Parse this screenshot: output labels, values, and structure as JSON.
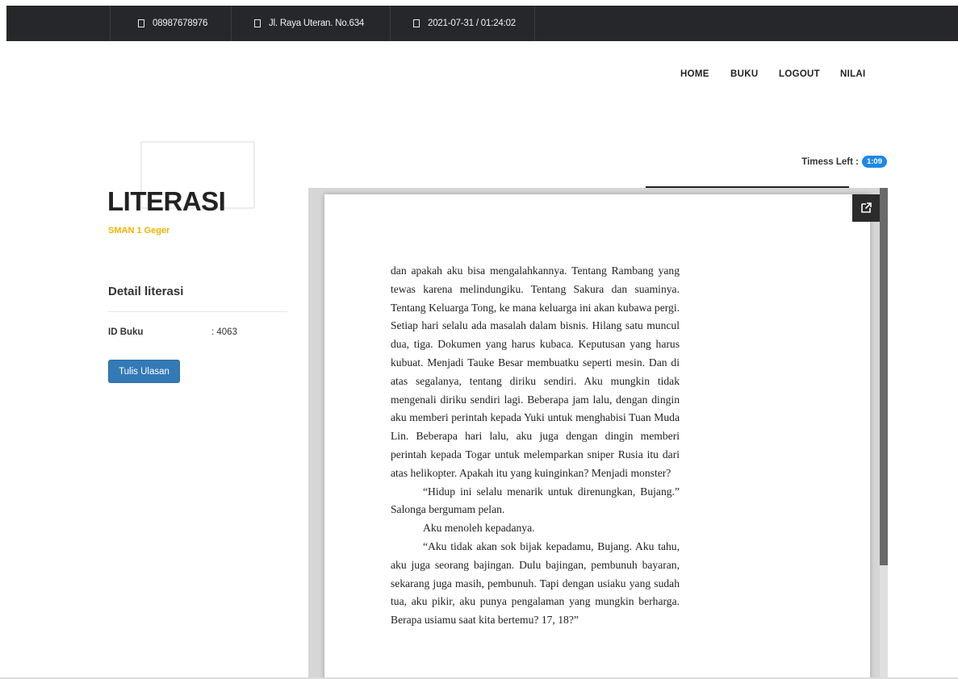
{
  "topbar": {
    "phone": "08987678976",
    "address": "Jl. Raya Uteran. No.634",
    "datetime": "2021-07-31 / 01:24:02"
  },
  "nav": {
    "home": "HOME",
    "buku": "BUKU",
    "logout": "LOGOUT",
    "nilai": "NILAI"
  },
  "brand": {
    "title": "LITERASI",
    "subtitle": "SMAN 1 Geger"
  },
  "detail": {
    "heading": "Detail literasi",
    "id_label": "ID Buku",
    "id_value": ": 4063",
    "button": "Tulis Ulasan"
  },
  "timer": {
    "label": "Timess Left :",
    "value": "1:09"
  },
  "reader": {
    "paragraphs": [
      "dan apakah aku bisa mengalahkannya. Tentang Rambang yang tewas karena melindungiku. Tentang Sakura dan suaminya. Tentang Keluarga Tong, ke mana keluarga ini akan kubawa pergi. Setiap hari selalu ada masalah dalam bisnis. Hilang satu muncul dua, tiga. Dokumen yang harus kubaca. Keputusan yang harus kubuat. Menjadi Tauke Besar membuatku seperti mesin. Dan di atas segalanya, tentang diriku sendiri. Aku mungkin tidak mengenali diriku sendiri lagi. Beberapa jam lalu, dengan dingin aku memberi perintah kepada Yuki untuk menghabisi Tuan Muda Lin. Beberapa hari lalu, aku juga dengan dingin memberi perintah kepada Togar untuk melemparkan sniper Rusia itu dari atas helikopter. Apakah itu yang kuinginkan? Menjadi monster?",
      "“Hidup ini selalu menarik untuk direnungkan, Bujang.” Salonga bergumam pelan.",
      "Aku menoleh kepadanya.",
      "“Aku tidak akan sok bijak kepadamu, Bujang. Aku tahu, aku juga seorang bajingan. Dulu bajingan, pembunuh bayaran, sekarang juga masih, pembunuh. Tapi dengan usiaku yang sudah tua, aku pikir, aku punya pengalaman yang mungkin berharga. Berapa usiamu saat kita bertemu? 17, 18?”"
    ]
  }
}
